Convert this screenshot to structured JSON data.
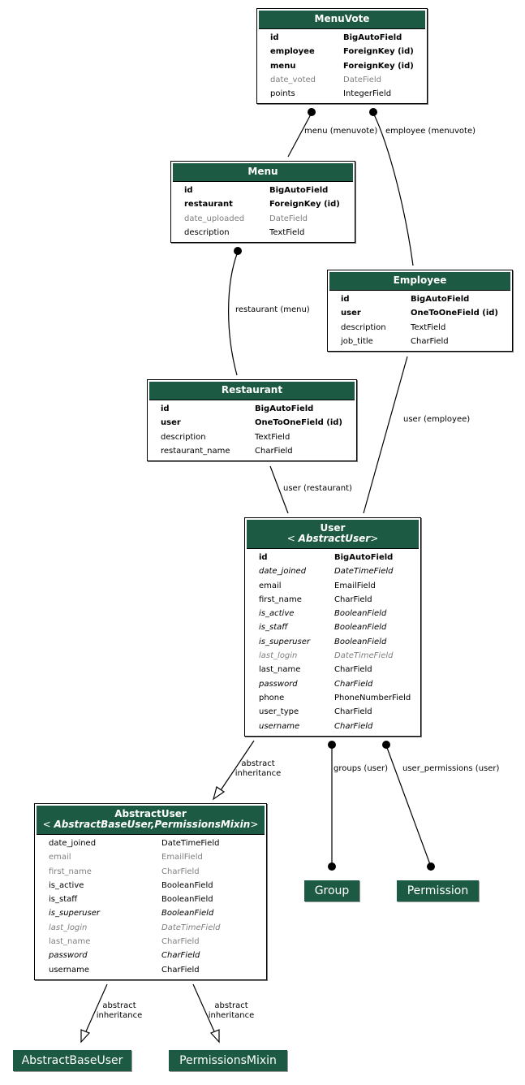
{
  "diagram": {
    "colors": {
      "header_bg": "#1d5a43",
      "header_text": "#ffffff",
      "border": "#000000",
      "muted_text": "#7f7f7f",
      "edge": "#000000"
    },
    "models": {
      "menuvote": {
        "title": "MenuVote",
        "fields": [
          {
            "name": "id",
            "type": "BigAutoField",
            "style": "pk"
          },
          {
            "name": "employee",
            "type": "ForeignKey (id)",
            "style": "fk"
          },
          {
            "name": "menu",
            "type": "ForeignKey (id)",
            "style": "fk"
          },
          {
            "name": "date_voted",
            "type": "DateField",
            "style": "null"
          },
          {
            "name": "points",
            "type": "IntegerField",
            "style": "normal"
          }
        ]
      },
      "menu": {
        "title": "Menu",
        "fields": [
          {
            "name": "id",
            "type": "BigAutoField",
            "style": "pk"
          },
          {
            "name": "restaurant",
            "type": "ForeignKey (id)",
            "style": "fk"
          },
          {
            "name": "date_uploaded",
            "type": "DateField",
            "style": "null"
          },
          {
            "name": "description",
            "type": "TextField",
            "style": "normal"
          }
        ]
      },
      "employee": {
        "title": "Employee",
        "fields": [
          {
            "name": "id",
            "type": "BigAutoField",
            "style": "pk"
          },
          {
            "name": "user",
            "type": "OneToOneField (id)",
            "style": "fk"
          },
          {
            "name": "description",
            "type": "TextField",
            "style": "normal"
          },
          {
            "name": "job_title",
            "type": "CharField",
            "style": "normal"
          }
        ]
      },
      "restaurant": {
        "title": "Restaurant",
        "fields": [
          {
            "name": "id",
            "type": "BigAutoField",
            "style": "pk"
          },
          {
            "name": "user",
            "type": "OneToOneField (id)",
            "style": "fk"
          },
          {
            "name": "description",
            "type": "TextField",
            "style": "normal"
          },
          {
            "name": "restaurant_name",
            "type": "CharField",
            "style": "normal"
          }
        ]
      },
      "user": {
        "title": "User",
        "parents": "AbstractUser",
        "fields": [
          {
            "name": "id",
            "type": "BigAutoField",
            "style": "pk"
          },
          {
            "name": "date_joined",
            "type": "DateTimeField",
            "style": "inh"
          },
          {
            "name": "email",
            "type": "EmailField",
            "style": "normal"
          },
          {
            "name": "first_name",
            "type": "CharField",
            "style": "normal"
          },
          {
            "name": "is_active",
            "type": "BooleanField",
            "style": "inh"
          },
          {
            "name": "is_staff",
            "type": "BooleanField",
            "style": "inh"
          },
          {
            "name": "is_superuser",
            "type": "BooleanField",
            "style": "inh"
          },
          {
            "name": "last_login",
            "type": "DateTimeField",
            "style": "inh null"
          },
          {
            "name": "last_name",
            "type": "CharField",
            "style": "normal"
          },
          {
            "name": "password",
            "type": "CharField",
            "style": "inh"
          },
          {
            "name": "phone",
            "type": "PhoneNumberField",
            "style": "normal"
          },
          {
            "name": "user_type",
            "type": "CharField",
            "style": "normal"
          },
          {
            "name": "username",
            "type": "CharField",
            "style": "inh"
          }
        ]
      },
      "abstractuser": {
        "title": "AbstractUser",
        "parents": "AbstractBaseUser,PermissionsMixin",
        "fields": [
          {
            "name": "date_joined",
            "type": "DateTimeField",
            "style": "normal"
          },
          {
            "name": "email",
            "type": "EmailField",
            "style": "null"
          },
          {
            "name": "first_name",
            "type": "CharField",
            "style": "null"
          },
          {
            "name": "is_active",
            "type": "BooleanField",
            "style": "normal"
          },
          {
            "name": "is_staff",
            "type": "BooleanField",
            "style": "normal"
          },
          {
            "name": "is_superuser",
            "type": "BooleanField",
            "style": "inh"
          },
          {
            "name": "last_login",
            "type": "DateTimeField",
            "style": "inh null"
          },
          {
            "name": "last_name",
            "type": "CharField",
            "style": "null"
          },
          {
            "name": "password",
            "type": "CharField",
            "style": "inh"
          },
          {
            "name": "username",
            "type": "CharField",
            "style": "normal"
          }
        ]
      }
    },
    "simple_nodes": {
      "group": "Group",
      "permission": "Permission",
      "abstractbaseuser": "AbstractBaseUser",
      "permissionsmixin": "PermissionsMixin"
    },
    "edge_labels": {
      "menu_menuvote": "menu (menuvote)",
      "employee_menuvote": "employee (menuvote)",
      "restaurant_menu": "restaurant (menu)",
      "user_employee": "user (employee)",
      "user_restaurant": "user (restaurant)",
      "groups_user": "groups (user)",
      "user_permissions_user": "user_permissions (user)",
      "abstract_inheritance_line1": "abstract",
      "abstract_inheritance_line2": "inheritance"
    }
  }
}
